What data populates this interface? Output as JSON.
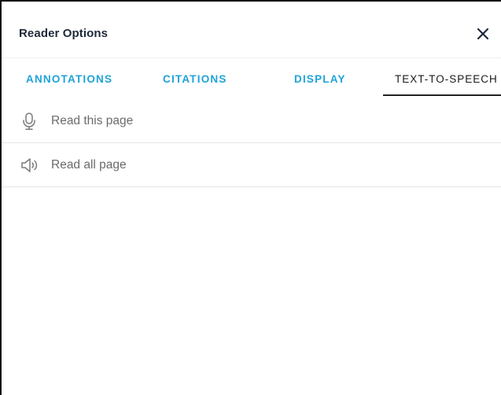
{
  "dialog": {
    "title": "Reader Options",
    "close_icon": "close-icon"
  },
  "tabs": [
    {
      "label": "ANNOTATIONS",
      "active": false
    },
    {
      "label": "CITATIONS",
      "active": false
    },
    {
      "label": "DISPLAY",
      "active": false
    },
    {
      "label": "TEXT-TO-SPEECH",
      "active": true
    }
  ],
  "options": [
    {
      "label": "Read this page",
      "icon": "microphone-icon"
    },
    {
      "label": "Read all page",
      "icon": "speaker-icon"
    }
  ],
  "colors": {
    "tab_inactive": "#1fa3d8",
    "tab_active": "#1a1a1a",
    "title": "#1e2a3a",
    "option_text": "#6b6b6b"
  }
}
